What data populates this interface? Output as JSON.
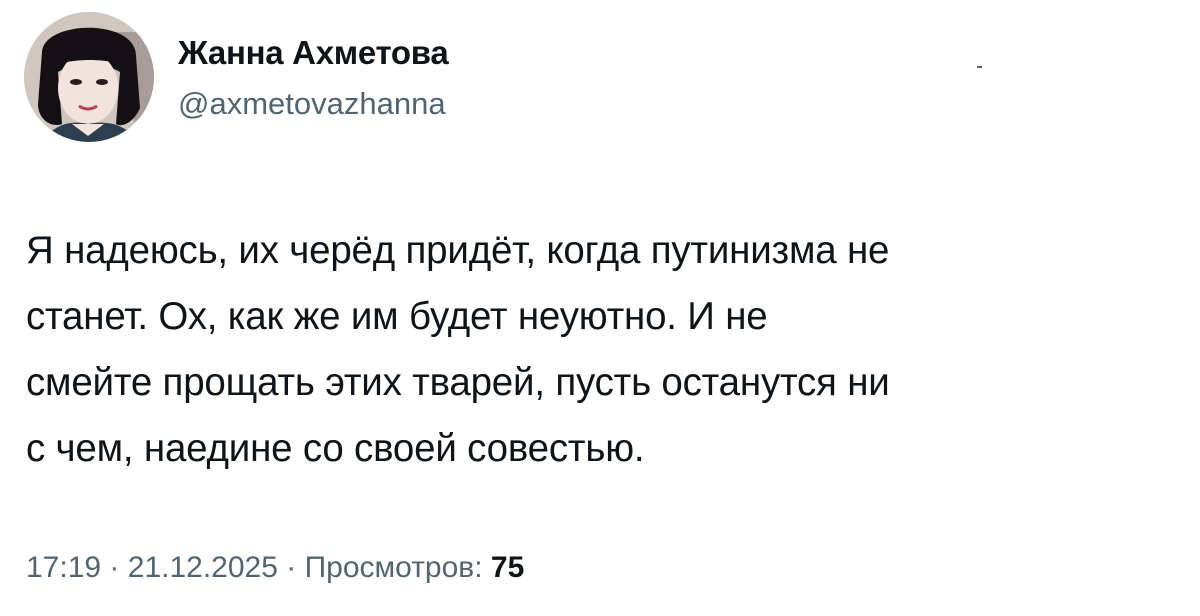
{
  "author": {
    "display_name": "Жанна Ахметова",
    "handle": "@axmetovazhanna",
    "avatar_icon": "avatar-photo"
  },
  "tweet": {
    "text_lines": [
      "Я надеюсь, их черёд придёт, когда путинизма не",
      "станет. Ох, как же им будет неуютно. И не",
      "смейте прощать этих тварей, пусть останутся ни",
      "с чем, наедине со своей совестью."
    ]
  },
  "meta": {
    "time": "17:19",
    "separator": "·",
    "date": "21.12.2025",
    "views_label": "Просмотров:",
    "views_count": "75"
  },
  "colors": {
    "text_primary": "#0f1419",
    "text_secondary": "#536471",
    "background": "#ffffff"
  }
}
